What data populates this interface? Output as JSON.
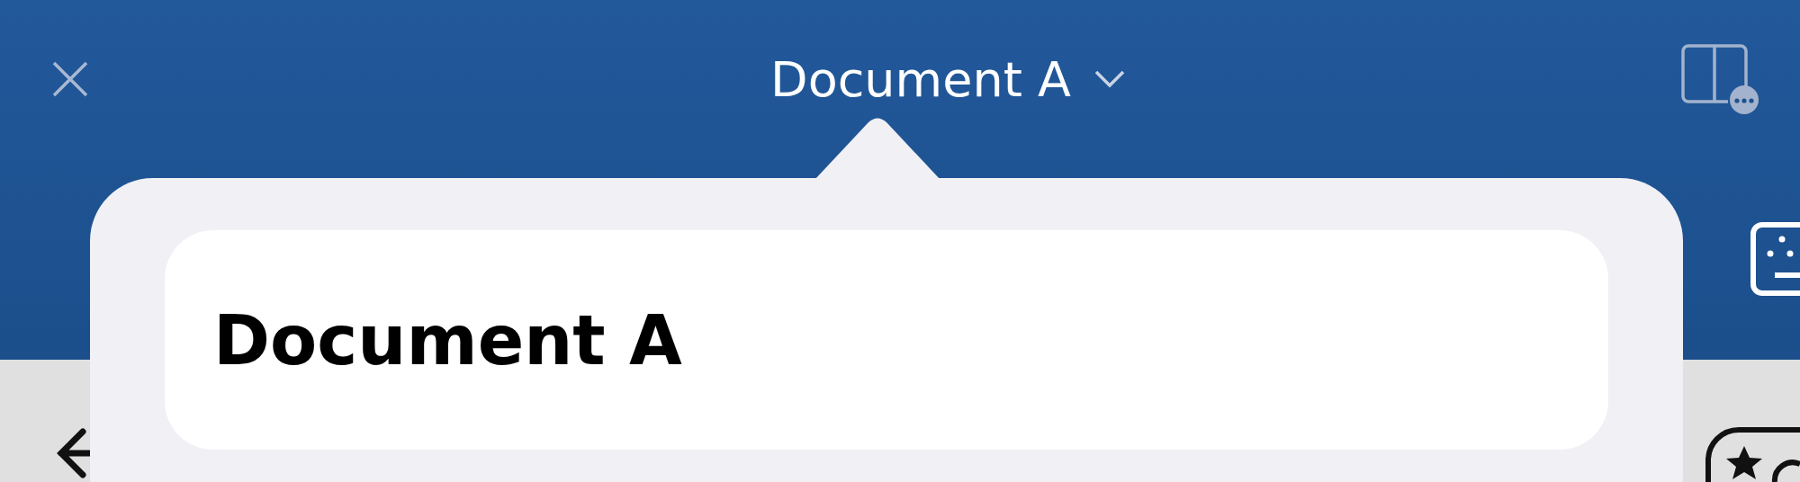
{
  "header": {
    "title": "Document A"
  },
  "rename_popover": {
    "name_field": {
      "value": "Document A"
    }
  }
}
